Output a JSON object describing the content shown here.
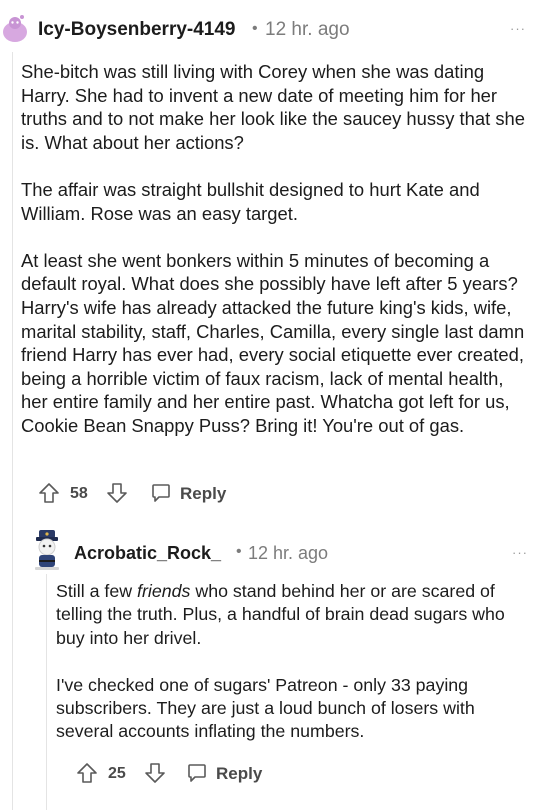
{
  "comment": {
    "username": "Icy-Boysenberry-4149",
    "separator": "•",
    "time": "12 hr. ago",
    "more": "···",
    "paragraphs": [
      "She-bitch was still living with Corey when she was dating Harry. She had to invent a new date of meeting him for her truths and to not make her look like the saucey hussy that she is. What about her actions?",
      "The affair was straight bullshit designed to hurt Kate and William. Rose was an easy target.",
      "At least she went bonkers within 5 minutes of becoming a default royal. What does she possibly have left after 5 years? Harry's wife has already attacked the future king's kids, wife, marital stability, staff, Charles, Camilla, every single last damn friend Harry has ever had, every social etiquette ever created, being a horrible victim of faux racism, lack of mental health, her entire family and her entire past. Whatcha got left for us, Cookie Bean Snappy Puss? Bring it! You're out of gas."
    ],
    "votes": "58",
    "reply_label": "Reply"
  },
  "reply": {
    "username": "Acrobatic_Rock_",
    "separator": "•",
    "time": "12 hr. ago",
    "more": "···",
    "p1_before": "Still a few ",
    "p1_em": "friends",
    "p1_after": " who stand behind her or are scared of telling the truth. Plus, a handful of brain dead sugars who buy into her drivel.",
    "p2": "I've checked one of sugars' Patreon - only 33 paying subscribers. They are just a loud bunch of losers with several accounts inflating the numbers.",
    "votes": "25",
    "reply_label": "Reply"
  },
  "icons": {
    "avatar1": "snoo-avatar-icon",
    "avatar2": "police-snoo-avatar-icon",
    "upvote": "upvote-arrow-icon",
    "downvote": "downvote-arrow-icon",
    "reply": "speech-bubble-icon",
    "more": "more-options-icon"
  },
  "colors": {
    "text": "#1c1c1c",
    "meta": "#7c7c7c",
    "thread": "#e4e4e4",
    "avatar1": "#d7a8e0"
  }
}
